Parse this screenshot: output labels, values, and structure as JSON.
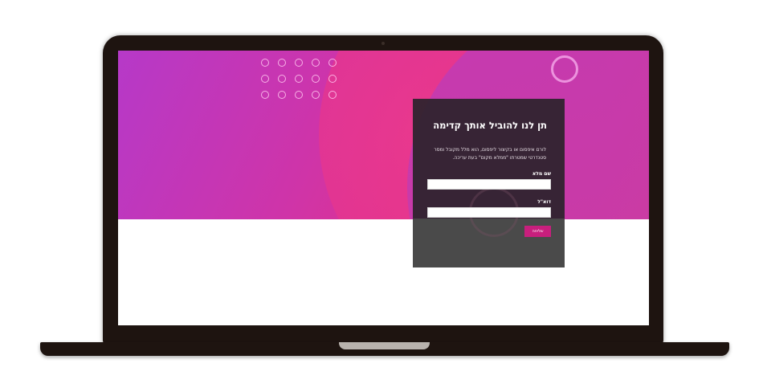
{
  "form": {
    "title": "תן לנו להוביל אותך קדימה",
    "description": "לורם איפסום או בקיצור ליפסום, הוא מלל מקובל ומסר סטנדרטי שמטרתו \"ממלא מקום\" בעת עריכה.",
    "name_label": "שם מלא",
    "name_value": "",
    "email_label": "דוא\"ל",
    "email_value": "",
    "submit_label": "שליחה"
  },
  "colors": {
    "hero_start": "#b639c8",
    "hero_end": "#ef3f6f",
    "form_background": "#2c222c",
    "button": "#c81f7d",
    "laptop_frame": "#1e1410"
  },
  "icons": {
    "decorative_dots": "dot-grid-pattern",
    "decorative_ring": "ring-shape"
  }
}
